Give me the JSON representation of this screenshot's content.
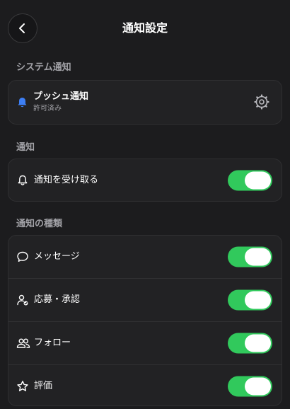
{
  "header": {
    "title": "通知設定",
    "back_icon": "chevron-left-icon"
  },
  "system_section": {
    "label": "システム通知",
    "push": {
      "title": "プッシュ通知",
      "status": "許可済み",
      "icon": "bell-icon",
      "action_icon": "gear-icon"
    }
  },
  "notify_section": {
    "label": "通知",
    "receive": {
      "label": "通知を受け取る",
      "icon": "bell-outline-icon",
      "enabled": true
    }
  },
  "types_section": {
    "label": "通知の種類",
    "items": [
      {
        "label": "メッセージ",
        "icon": "chat-bubble-icon",
        "enabled": true
      },
      {
        "label": "応募・承認",
        "icon": "user-check-icon",
        "enabled": true
      },
      {
        "label": "フォロー",
        "icon": "users-icon",
        "enabled": true
      },
      {
        "label": "評価",
        "icon": "star-icon",
        "enabled": true
      }
    ]
  },
  "colors": {
    "background": "#1c1c1e",
    "card": "#222224",
    "toggle_on": "#31c95c",
    "accent_blue": "#3d7ff5",
    "muted_text": "#a2a2a7"
  }
}
